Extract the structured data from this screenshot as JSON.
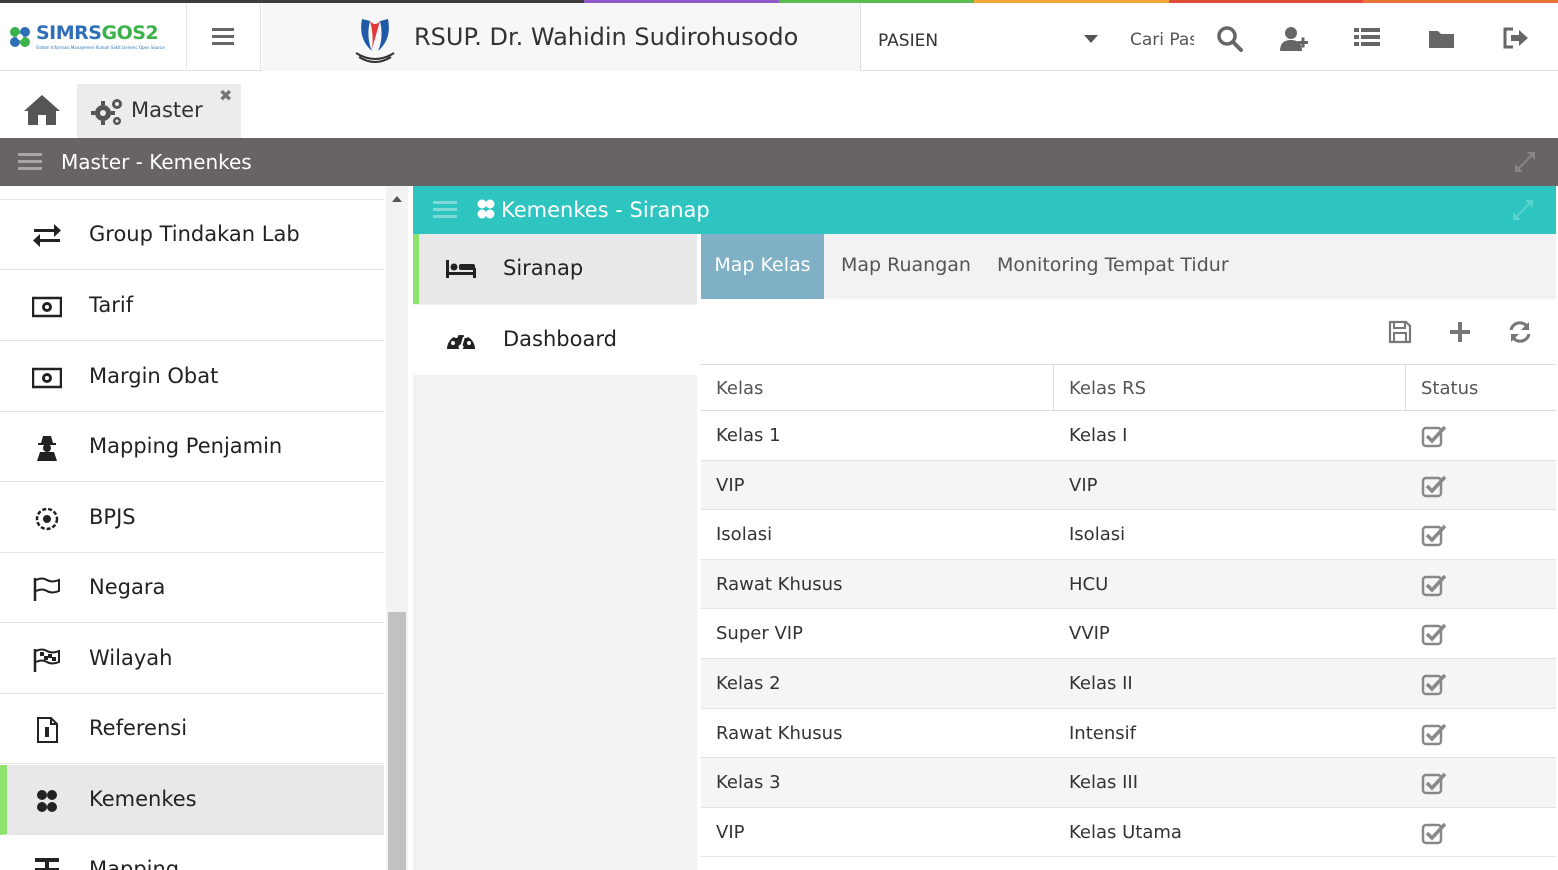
{
  "app": {
    "logo_text_a": "SIMRS",
    "logo_text_b": "GOS2",
    "logo_sub": "Sistem Informasi Manajemen Rumah Sakit Generic Open Source",
    "hospital_name": "RSUP. Dr. Wahidin Sudirohusodo"
  },
  "header": {
    "patient_select_value": "PASIEN",
    "search_placeholder": "Cari Pasien",
    "icons": [
      "menu-icon",
      "search-icon",
      "user-plus-icon",
      "list-icon",
      "folder-icon",
      "sign-out-icon"
    ]
  },
  "tabs_bar": {
    "home_icon": "home-icon",
    "open_tab_label": "Master",
    "open_tab_close": "✖"
  },
  "module": {
    "title": "Master - Kemenkes"
  },
  "sidebar": {
    "items": [
      {
        "label": "Group Tindakan Lab",
        "icon": "exchange-icon"
      },
      {
        "label": "Tarif",
        "icon": "money-icon"
      },
      {
        "label": "Margin Obat",
        "icon": "money-icon"
      },
      {
        "label": "Mapping Penjamin",
        "icon": "user-secret-icon"
      },
      {
        "label": "BPJS",
        "icon": "bpjs-icon"
      },
      {
        "label": "Negara",
        "icon": "flag-icon"
      },
      {
        "label": "Wilayah",
        "icon": "flag-checkered-icon"
      },
      {
        "label": "Referensi",
        "icon": "file-icon"
      },
      {
        "label": "Kemenkes",
        "icon": "kemenkes-icon",
        "active": true
      },
      {
        "label": "Mapping",
        "icon": "mapping-icon"
      }
    ]
  },
  "panel": {
    "title": "Kemenkes - Siranap",
    "subnav": [
      {
        "label": "Siranap",
        "icon": "bed-icon",
        "active": true
      },
      {
        "label": "Dashboard",
        "icon": "dashboard-icon"
      }
    ],
    "tabs": [
      {
        "label": "Map Kelas",
        "active": true
      },
      {
        "label": "Map Ruangan"
      },
      {
        "label": "Monitoring Tempat Tidur"
      }
    ],
    "toolbar": [
      "save-icon",
      "plus-icon",
      "refresh-icon"
    ],
    "grid": {
      "columns": [
        "Kelas",
        "Kelas RS",
        "Status"
      ],
      "rows": [
        {
          "kelas": "Kelas 1",
          "kelas_rs": "Kelas I",
          "status": true
        },
        {
          "kelas": "VIP",
          "kelas_rs": "VIP",
          "status": true
        },
        {
          "kelas": "Isolasi",
          "kelas_rs": "Isolasi",
          "status": true
        },
        {
          "kelas": "Rawat Khusus",
          "kelas_rs": "HCU",
          "status": true
        },
        {
          "kelas": "Super VIP",
          "kelas_rs": "VVIP",
          "status": true
        },
        {
          "kelas": "Kelas 2",
          "kelas_rs": "Kelas II",
          "status": true
        },
        {
          "kelas": "Rawat Khusus",
          "kelas_rs": "Intensif",
          "status": true
        },
        {
          "kelas": "Kelas 3",
          "kelas_rs": "Kelas III",
          "status": true
        },
        {
          "kelas": "VIP",
          "kelas_rs": "Kelas Utama",
          "status": true
        }
      ]
    }
  },
  "colors": {
    "panel_header": "#2ec4c0",
    "module_bar": "#686463",
    "active_tab": "#7fb0c5",
    "active_indicator": "#8ee36f"
  }
}
